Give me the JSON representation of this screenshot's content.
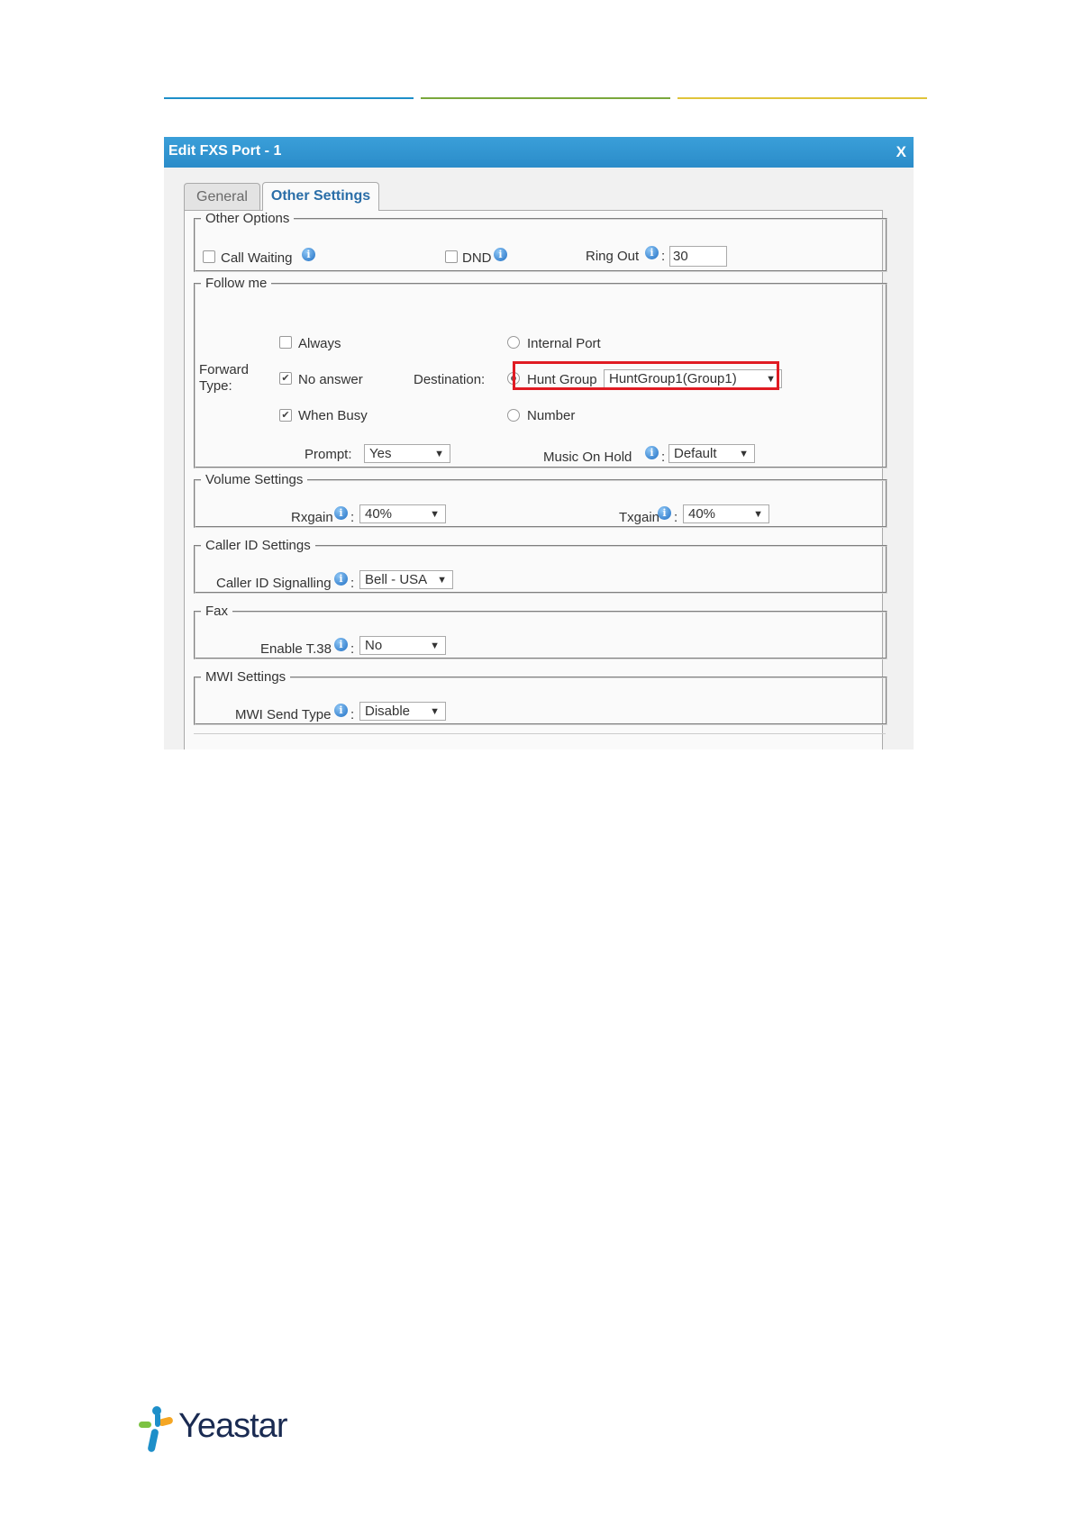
{
  "header_lines": {
    "colors": [
      "#1e8fc9",
      "#7aa83c",
      "#e0c43a"
    ]
  },
  "dialog": {
    "title": "Edit FXS Port - 1",
    "close": "X"
  },
  "tabs": {
    "general": "General",
    "other": "Other Settings"
  },
  "other_options": {
    "legend": "Other Options",
    "call_waiting": {
      "label": "Call Waiting",
      "checked": false
    },
    "dnd": {
      "label": "DND",
      "checked": false
    },
    "ring_out": {
      "label": "Ring Out",
      "colon": ":",
      "value": "30"
    }
  },
  "follow_me": {
    "legend": "Follow me",
    "forward_type_label": "Forward\nType:",
    "always": {
      "label": "Always",
      "checked": false
    },
    "no_answer": {
      "label": "No answer",
      "checked": true
    },
    "when_busy": {
      "label": "When Busy",
      "checked": true
    },
    "destination_label": "Destination:",
    "internal_port": {
      "label": "Internal Port",
      "selected": false
    },
    "hunt_group": {
      "label": "Hunt Group",
      "selected": true,
      "value": "HuntGroup1(Group1)"
    },
    "number": {
      "label": "Number",
      "selected": false
    },
    "prompt": {
      "label": "Prompt:",
      "value": "Yes"
    },
    "music_on_hold": {
      "label": "Music On Hold",
      "colon": ":",
      "value": "Default"
    }
  },
  "volume": {
    "legend": "Volume Settings",
    "rxgain": {
      "label": "Rxgain",
      "colon": ":",
      "value": "40%"
    },
    "txgain": {
      "label": "Txgain",
      "colon": ":",
      "value": "40%"
    }
  },
  "caller_id": {
    "legend": "Caller ID Settings",
    "signalling": {
      "label": "Caller ID Signalling",
      "colon": ":",
      "value": "Bell - USA"
    }
  },
  "fax": {
    "legend": "Fax",
    "t38": {
      "label": "Enable T.38",
      "colon": ":",
      "value": "No"
    }
  },
  "mwi": {
    "legend": "MWI Settings",
    "send_type": {
      "label": "MWI Send Type",
      "colon": ":",
      "value": "Disable"
    }
  },
  "icons": {
    "info": "i",
    "check": "✔",
    "dropdown": "▼"
  },
  "logo": {
    "text": "Yeastar",
    "colors": [
      "#f5a623",
      "#7cc242",
      "#1e8fc9"
    ]
  }
}
